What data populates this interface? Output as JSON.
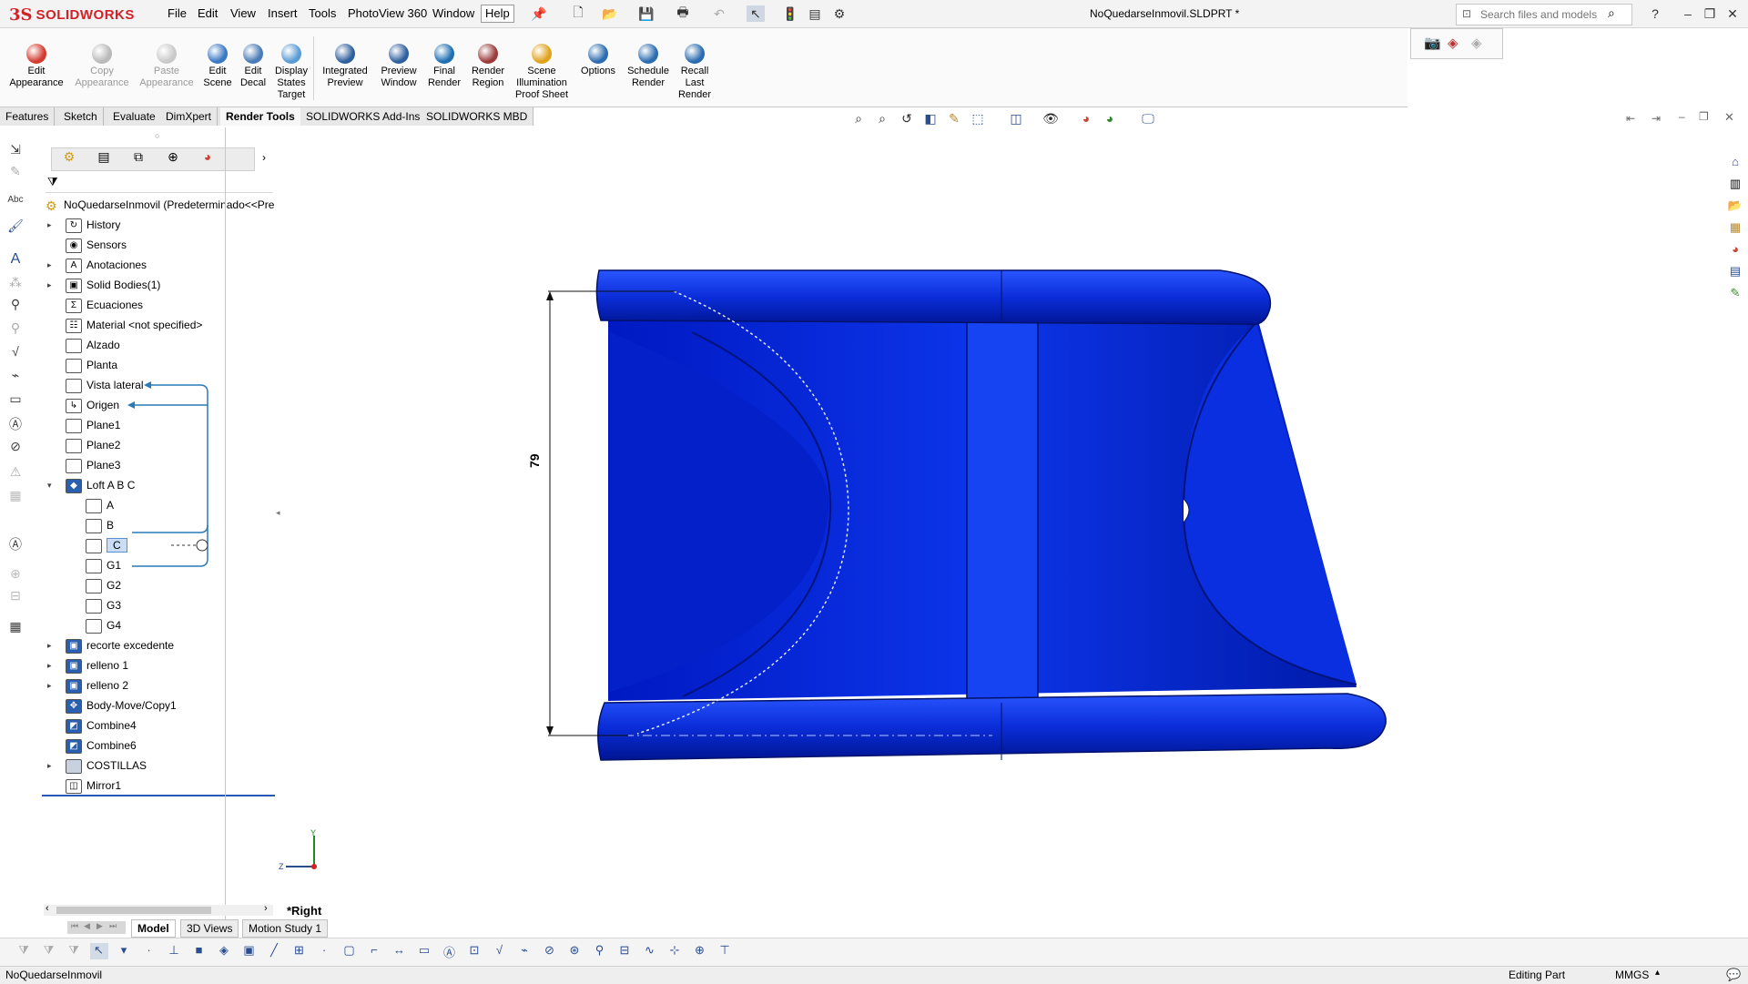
{
  "app": {
    "brand_mark": "3S",
    "brand_name": "SOLIDWORKS"
  },
  "menu": [
    "File",
    "Edit",
    "View",
    "Insert",
    "Tools",
    "PhotoView 360",
    "Window",
    "Help"
  ],
  "document_title": "NoQuedarseInmovil.SLDPRT *",
  "search": {
    "placeholder": "Search files and models"
  },
  "ribbon": [
    {
      "label": "Edit Appearance",
      "icon": "appearance-icon",
      "color": "#d33b2f",
      "enabled": true
    },
    {
      "label": "Copy Appearance",
      "icon": "copy-appearance-icon",
      "color": "#b9b9b9",
      "enabled": false
    },
    {
      "label": "Paste Appearance",
      "icon": "paste-appearance-icon",
      "color": "#c9c9c9",
      "enabled": false
    },
    {
      "label": "Edit Scene",
      "icon": "scene-icon",
      "color": "#3a78c4",
      "enabled": true
    },
    {
      "label": "Edit Decal",
      "icon": "decal-icon",
      "color": "#4a7bb7",
      "enabled": true
    },
    {
      "label": "Display States Target",
      "icon": "display-states-icon",
      "color": "#5b9bd5",
      "enabled": true
    },
    {
      "label": "Integrated Preview",
      "icon": "integrated-preview-icon",
      "color": "#2f5f9e",
      "enabled": true
    },
    {
      "label": "Preview Window",
      "icon": "preview-window-icon",
      "color": "#2f5f9e",
      "enabled": true
    },
    {
      "label": "Final Render",
      "icon": "final-render-icon",
      "color": "#1f6fb2",
      "enabled": true
    },
    {
      "label": "Render Region",
      "icon": "render-region-icon",
      "color": "#9b3b3b",
      "enabled": true
    },
    {
      "label": "Scene Illumination Proof Sheet",
      "icon": "proof-sheet-icon",
      "color": "#e0a21c",
      "enabled": true
    },
    {
      "label": "Options",
      "icon": "options-icon",
      "color": "#2b6cb0",
      "enabled": true
    },
    {
      "label": "Schedule Render",
      "icon": "schedule-render-icon",
      "color": "#2b6cb0",
      "enabled": true
    },
    {
      "label": "Recall Last Render",
      "icon": "recall-render-icon",
      "color": "#2b6cb0",
      "enabled": true
    }
  ],
  "tabs": [
    "Features",
    "Sketch",
    "Evaluate",
    "DimXpert",
    "Render Tools",
    "SOLIDWORKS Add-Ins",
    "SOLIDWORKS MBD"
  ],
  "active_tab": "Render Tools",
  "tree": {
    "root": "NoQuedarseInmovil  (Predeterminado<<Pre",
    "items": [
      {
        "label": "History",
        "icon": "history-icon",
        "expandable": true
      },
      {
        "label": "Sensors",
        "icon": "sensor-icon",
        "expandable": false
      },
      {
        "label": "Anotaciones",
        "icon": "annotations-icon",
        "expandable": true
      },
      {
        "label": "Solid Bodies(1)",
        "icon": "solid-bodies-icon",
        "expandable": true
      },
      {
        "label": "Ecuaciones",
        "icon": "equations-icon",
        "expandable": false
      },
      {
        "label": "Material <not specified>",
        "icon": "material-icon",
        "expandable": false
      },
      {
        "label": "Alzado",
        "icon": "plane-icon",
        "expandable": false
      },
      {
        "label": "Planta",
        "icon": "plane-icon",
        "expandable": false
      },
      {
        "label": "Vista lateral",
        "icon": "plane-icon",
        "expandable": false
      },
      {
        "label": "Origen",
        "icon": "origin-icon",
        "expandable": false
      },
      {
        "label": "Plane1",
        "icon": "plane-icon",
        "expandable": false
      },
      {
        "label": "Plane2",
        "icon": "plane-icon",
        "expandable": false
      },
      {
        "label": "Plane3",
        "icon": "plane-icon",
        "expandable": false
      },
      {
        "label": "Loft A B C",
        "icon": "loft-icon",
        "expandable": true,
        "expanded": true
      },
      {
        "label": "A",
        "icon": "sketch-icon",
        "child": true
      },
      {
        "label": "B",
        "icon": "sketch-icon",
        "child": true
      },
      {
        "label": "C",
        "icon": "sketch-icon",
        "child": true,
        "selected": true
      },
      {
        "label": "G1",
        "icon": "sketch-icon",
        "child": true
      },
      {
        "label": "G2",
        "icon": "sketch-icon",
        "child": true
      },
      {
        "label": "G3",
        "icon": "sketch-icon",
        "child": true
      },
      {
        "label": "G4",
        "icon": "sketch-icon",
        "child": true
      },
      {
        "label": "recorte excedente",
        "icon": "cut-icon",
        "expandable": true
      },
      {
        "label": "relleno 1",
        "icon": "fill-icon",
        "expandable": true
      },
      {
        "label": "relleno 2",
        "icon": "fill-icon",
        "expandable": true
      },
      {
        "label": "Body-Move/Copy1",
        "icon": "move-copy-icon",
        "expandable": false
      },
      {
        "label": "Combine4",
        "icon": "combine-icon",
        "expandable": false
      },
      {
        "label": "Combine6",
        "icon": "combine-icon",
        "expandable": false
      },
      {
        "label": "COSTILLAS",
        "icon": "folder-icon",
        "expandable": true
      },
      {
        "label": "Mirror1",
        "icon": "mirror-icon",
        "expandable": false
      }
    ]
  },
  "viewport": {
    "view_name": "*Right",
    "dimension": "79",
    "part_color": "#0a2bd6",
    "axis_y": "Y",
    "axis_z": "Z"
  },
  "model_tabs": [
    "Model",
    "3D Views",
    "Motion Study 1"
  ],
  "status": {
    "file": "NoQuedarseInmovil",
    "mode": "Editing Part",
    "units": "MMGS"
  }
}
